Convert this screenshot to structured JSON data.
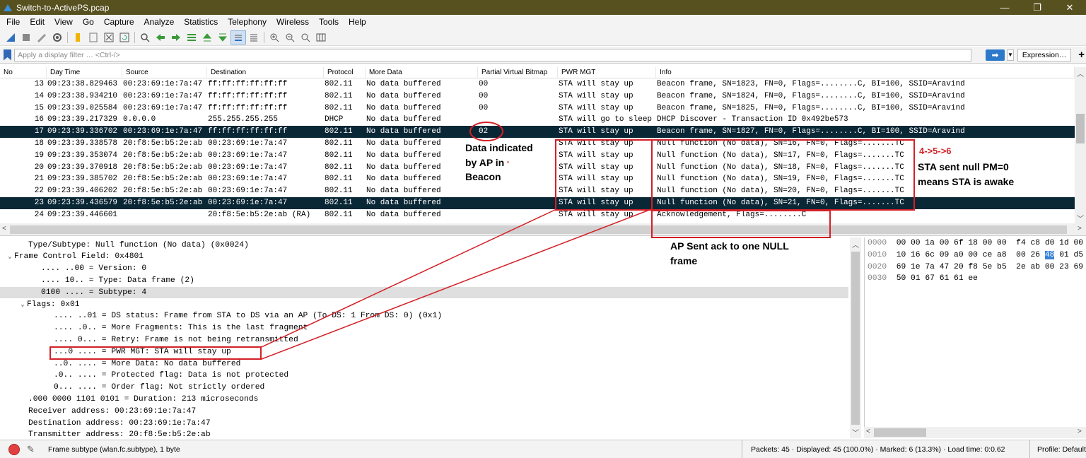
{
  "window": {
    "title": "Switch-to-ActivePS.pcap",
    "controls": [
      "—",
      "❐",
      "✕"
    ]
  },
  "menu": [
    "File",
    "Edit",
    "View",
    "Go",
    "Capture",
    "Analyze",
    "Statistics",
    "Telephony",
    "Wireless",
    "Tools",
    "Help"
  ],
  "filter": {
    "placeholder": "Apply a display filter … <Ctrl-/>",
    "expression_label": "Expression…",
    "plus_label": "+"
  },
  "packet_list": {
    "columns": [
      "No",
      "Day Time",
      "Source",
      "Destination",
      "Protocol",
      "More Data",
      "Partial Virtual Bitmap",
      "PWR MGT",
      "Info"
    ],
    "rows": [
      {
        "no": "13",
        "time": "09:23:38.829463",
        "src": "00:23:69:1e:7a:47",
        "dst": "ff:ff:ff:ff:ff:ff",
        "proto": "802.11",
        "more": "No data buffered",
        "pvb": "00",
        "pwr": "STA will stay up",
        "info": "Beacon frame, SN=1823, FN=0, Flags=........C, BI=100, SSID=Aravind"
      },
      {
        "no": "14",
        "time": "09:23:38.934210",
        "src": "00:23:69:1e:7a:47",
        "dst": "ff:ff:ff:ff:ff:ff",
        "proto": "802.11",
        "more": "No data buffered",
        "pvb": "00",
        "pwr": "STA will stay up",
        "info": "Beacon frame, SN=1824, FN=0, Flags=........C, BI=100, SSID=Aravind"
      },
      {
        "no": "15",
        "time": "09:23:39.025584",
        "src": "00:23:69:1e:7a:47",
        "dst": "ff:ff:ff:ff:ff:ff",
        "proto": "802.11",
        "more": "No data buffered",
        "pvb": "00",
        "pwr": "STA will stay up",
        "info": "Beacon frame, SN=1825, FN=0, Flags=........C, BI=100, SSID=Aravind"
      },
      {
        "no": "16",
        "time": "09:23:39.217329",
        "src": "0.0.0.0",
        "dst": "255.255.255.255",
        "proto": "DHCP",
        "more": "No data buffered",
        "pvb": "",
        "pwr": "STA will go to sleep",
        "info": "DHCP Discover - Transaction ID 0x492be573"
      },
      {
        "no": "17",
        "time": "09:23:39.336702",
        "src": "00:23:69:1e:7a:47",
        "dst": "ff:ff:ff:ff:ff:ff",
        "proto": "802.11",
        "more": "No data buffered",
        "pvb": "02",
        "pwr": "STA will stay up",
        "info": "Beacon frame, SN=1827, FN=0, Flags=........C, BI=100, SSID=Aravind",
        "selected": true
      },
      {
        "no": "18",
        "time": "09:23:39.338578",
        "src": "20:f8:5e:b5:2e:ab",
        "dst": "00:23:69:1e:7a:47",
        "proto": "802.11",
        "more": "No data buffered",
        "pvb": "",
        "pwr": "STA will stay up",
        "info": "Null function (No data), SN=16, FN=0, Flags=.......TC"
      },
      {
        "no": "19",
        "time": "09:23:39.353074",
        "src": "20:f8:5e:b5:2e:ab",
        "dst": "00:23:69:1e:7a:47",
        "proto": "802.11",
        "more": "No data buffered",
        "pvb": "",
        "pwr": "STA will stay up",
        "info": "Null function (No data), SN=17, FN=0, Flags=.......TC"
      },
      {
        "no": "20",
        "time": "09:23:39.370918",
        "src": "20:f8:5e:b5:2e:ab",
        "dst": "00:23:69:1e:7a:47",
        "proto": "802.11",
        "more": "No data buffered",
        "pvb": "",
        "pwr": "STA will stay up",
        "info": "Null function (No data), SN=18, FN=0, Flags=.......TC"
      },
      {
        "no": "21",
        "time": "09:23:39.385702",
        "src": "20:f8:5e:b5:2e:ab",
        "dst": "00:23:69:1e:7a:47",
        "proto": "802.11",
        "more": "No data buffered",
        "pvb": "",
        "pwr": "STA will stay up",
        "info": "Null function (No data), SN=19, FN=0, Flags=.......TC"
      },
      {
        "no": "22",
        "time": "09:23:39.406202",
        "src": "20:f8:5e:b5:2e:ab",
        "dst": "00:23:69:1e:7a:47",
        "proto": "802.11",
        "more": "No data buffered",
        "pvb": "",
        "pwr": "STA will stay up",
        "info": "Null function (No data), SN=20, FN=0, Flags=.......TC"
      },
      {
        "no": "23",
        "time": "09:23:39.436579",
        "src": "20:f8:5e:b5:2e:ab",
        "dst": "00:23:69:1e:7a:47",
        "proto": "802.11",
        "more": "No data buffered",
        "pvb": "",
        "pwr": "STA will stay up",
        "info": "Null function (No data), SN=21, FN=0, Flags=.......TC",
        "selected": true
      },
      {
        "no": "24",
        "time": "09:23:39.446601",
        "src": "",
        "dst": "20:f8:5e:b5:2e:ab (RA)",
        "proto": "802.11",
        "more": "No data buffered",
        "pvb": "",
        "pwr": "STA will stay up",
        "info": "Acknowledgement, Flags=........C"
      }
    ]
  },
  "details": {
    "lines": [
      {
        "indent": 2,
        "tw": "",
        "text": "Type/Subtype: Null function (No data) (0x0024)"
      },
      {
        "indent": 0,
        "tw": "v",
        "text": "Frame Control Field: 0x4801"
      },
      {
        "indent": 4,
        "tw": "",
        "text": ".... ..00 = Version: 0"
      },
      {
        "indent": 4,
        "tw": "",
        "text": ".... 10.. = Type: Data frame (2)"
      },
      {
        "indent": 4,
        "tw": "",
        "text": "0100 .... = Subtype: 4",
        "hl": true
      },
      {
        "indent": 2,
        "tw": "v",
        "text": "Flags: 0x01"
      },
      {
        "indent": 6,
        "tw": "",
        "text": ".... ..01 = DS status: Frame from STA to DS via an AP (To DS: 1 From DS: 0) (0x1)"
      },
      {
        "indent": 6,
        "tw": "",
        "text": ".... .0.. = More Fragments: This is the last fragment"
      },
      {
        "indent": 6,
        "tw": "",
        "text": ".... 0... = Retry: Frame is not being retransmitted"
      },
      {
        "indent": 6,
        "tw": "",
        "text": "...0 .... = PWR MGT: STA will stay up"
      },
      {
        "indent": 6,
        "tw": "",
        "text": "..0. .... = More Data: No data buffered"
      },
      {
        "indent": 6,
        "tw": "",
        "text": ".0.. .... = Protected flag: Data is not protected"
      },
      {
        "indent": 6,
        "tw": "",
        "text": "0... .... = Order flag: Not strictly ordered"
      },
      {
        "indent": 2,
        "tw": "",
        "text": ".000 0000 1101 0101 = Duration: 213 microseconds"
      },
      {
        "indent": 2,
        "tw": "",
        "text": "Receiver address: 00:23:69:1e:7a:47"
      },
      {
        "indent": 2,
        "tw": "",
        "text": "Destination address: 00:23:69:1e:7a:47"
      },
      {
        "indent": 2,
        "tw": "",
        "text": "Transmitter address: 20:f8:5e:b5:2e:ab"
      }
    ]
  },
  "hex": {
    "lines": [
      {
        "off": "0000",
        "a": "00 00 1a 00 6f 18 00 00  f4 c8 d0 1d 00 0",
        "b": "",
        "c": ""
      },
      {
        "off": "0010",
        "a": "10 16 6c 09 a0 00 ce a8  00 26 ",
        "b": "48",
        "c": " 01 d5 0"
      },
      {
        "off": "0020",
        "a": "69 1e 7a 47 20 f8 5e b5  2e ab 00 23 69 1",
        "b": "",
        "c": ""
      },
      {
        "off": "0030",
        "a": "50 01 67 61 61 ee",
        "b": "",
        "c": ""
      }
    ]
  },
  "status": {
    "message": "Frame subtype (wlan.fc.subtype), 1 byte",
    "stats": "Packets: 45 · Displayed: 45 (100.0%) · Marked: 6 (13.3%) · Load time: 0:0.62",
    "profile": "Profile: Default"
  },
  "annotations": {
    "beacon_note": [
      "Data indicated",
      "by AP in",
      "Beacon"
    ],
    "beacon_dot": "•",
    "sequence": "4->5->6",
    "sta_note": [
      "STA sent null PM=0",
      "means STA is awake"
    ],
    "ack_note": [
      "AP Sent ack to one NULL",
      "frame"
    ]
  },
  "colors": {
    "accent_red": "#d32026",
    "selected_row": "#0a2736",
    "titlebar": "#57501f"
  }
}
